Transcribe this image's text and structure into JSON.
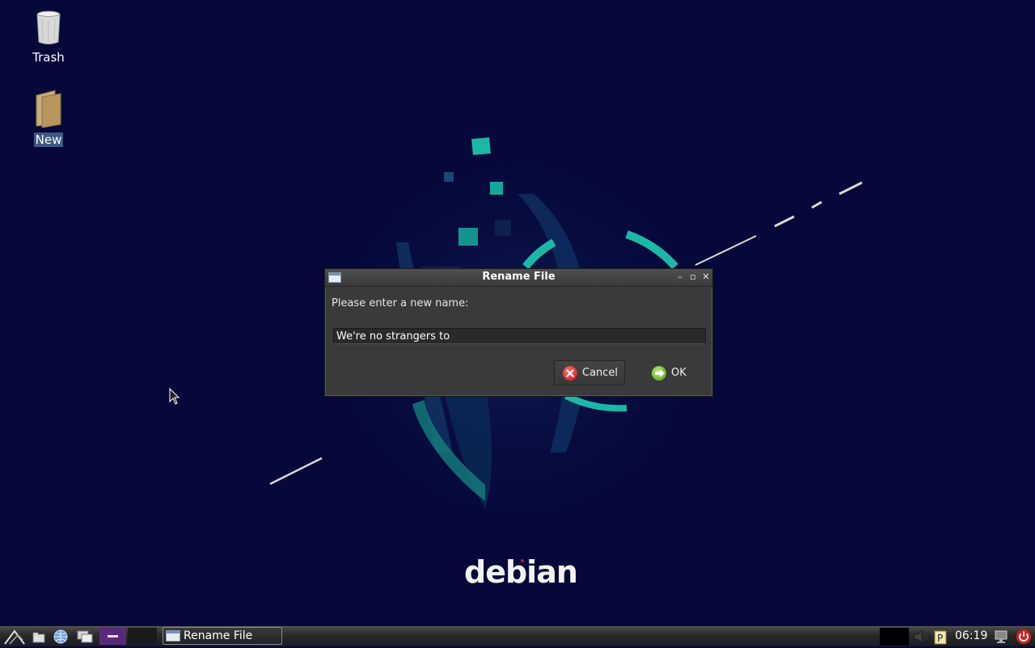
{
  "desktop": {
    "icons": [
      {
        "label": "Trash"
      },
      {
        "label": "New"
      }
    ],
    "wallpaper_brand": "debian"
  },
  "dialog": {
    "title": "Rename File",
    "prompt": "Please enter a new name:",
    "input_value": "We're no strangers to",
    "cancel_label": "Cancel",
    "ok_label": "OK",
    "wm_buttons": {
      "minimize": "–",
      "maximize": "▫",
      "close": "✕"
    }
  },
  "taskbar": {
    "task_label": "Rename File",
    "clock": "06:19"
  },
  "colors": {
    "desktop_bg": "#06083a",
    "accent_teal": "#1bb8a6",
    "dialog_bg": "#3a3a3a",
    "workspace_active": "#5a2a7a"
  }
}
